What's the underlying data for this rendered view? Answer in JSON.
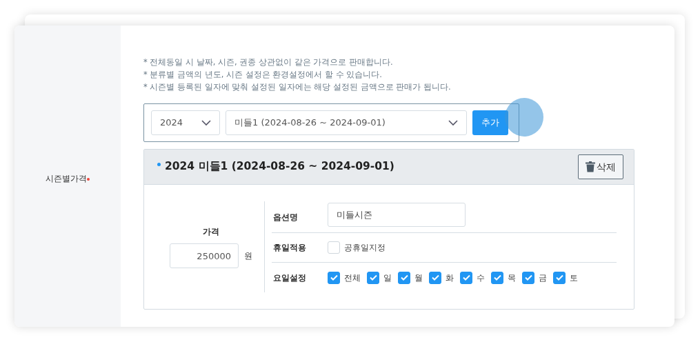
{
  "field_label": "시즌별가격",
  "required": true,
  "notes": [
    "* 전체동일 시 날짜, 시즌, 권종 상관없이 같은 가격으로 판매합니다.",
    "* 분류별 금액의 년도, 시즌 설정은 환경설정에서 할 수 있습니다.",
    "* 시즌별 등록된 일자에 맞춰 설정된 일자에는 해당 설정된 금액으로 판매가 됩니다."
  ],
  "selector": {
    "year": "2024",
    "season": "미들1 (2024-08-26 ~ 2024-09-01)",
    "add_button": "추가"
  },
  "seasons": [
    {
      "title": "2024 미들1 (2024-08-26 ~ 2024-09-01)",
      "delete_button": "삭제",
      "price_label": "가격",
      "price": "250000",
      "currency": "원",
      "option_name_label": "옵션명",
      "option_name": "미들시즌",
      "holiday_label": "휴일적용",
      "holiday_option": {
        "label": "공휴일지정",
        "checked": false
      },
      "days_label": "요일설정",
      "days": [
        {
          "label": "전체",
          "checked": true
        },
        {
          "label": "일",
          "checked": true
        },
        {
          "label": "월",
          "checked": true
        },
        {
          "label": "화",
          "checked": true
        },
        {
          "label": "수",
          "checked": true
        },
        {
          "label": "목",
          "checked": true
        },
        {
          "label": "금",
          "checked": true
        },
        {
          "label": "토",
          "checked": true
        }
      ]
    }
  ]
}
